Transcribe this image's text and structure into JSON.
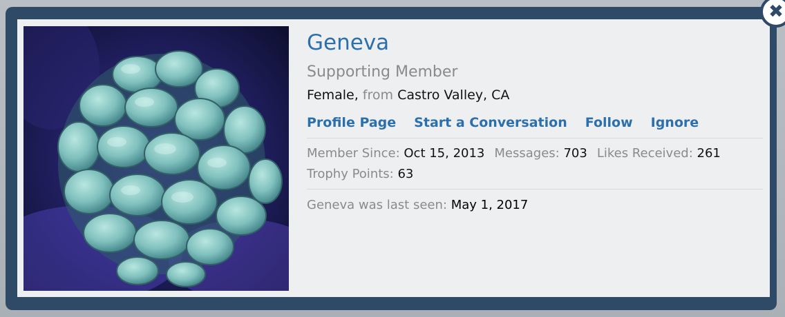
{
  "profile": {
    "username": "Geneva",
    "user_title": "Supporting Member",
    "gender": "Female,",
    "from_label": "from",
    "location": "Castro Valley, CA",
    "avatar_icon": "coral-avatar-icon"
  },
  "links": [
    {
      "label": "Profile Page"
    },
    {
      "label": "Start a Conversation"
    },
    {
      "label": "Follow"
    },
    {
      "label": "Ignore"
    }
  ],
  "stats": {
    "member_since": {
      "label": "Member Since:",
      "value": "Oct 15, 2013"
    },
    "messages": {
      "label": "Messages:",
      "value": "703"
    },
    "likes": {
      "label": "Likes Received:",
      "value": "261"
    },
    "trophy": {
      "label": "Trophy Points:",
      "value": "63"
    }
  },
  "last_seen": {
    "label": "Geneva was last seen:",
    "value": "May 1, 2017"
  },
  "close_icon": "close-icon",
  "colors": {
    "accent": "#2b6fad",
    "frame": "#2f4a66",
    "muted": "#8a8a8a",
    "card": "#eeeff0"
  }
}
